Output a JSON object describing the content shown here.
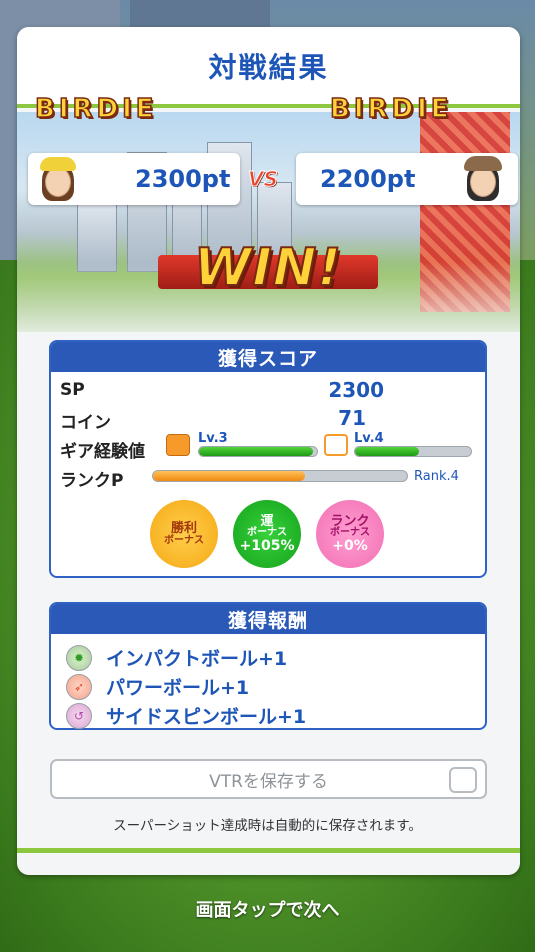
{
  "title": "対戦結果",
  "players": {
    "left": {
      "badge": "BIRDIE",
      "points": "2300pt"
    },
    "right": {
      "badge": "BIRDIE",
      "points": "2200pt"
    },
    "vs": "VS"
  },
  "result": "WIN!",
  "score": {
    "header": "獲得スコア",
    "sp_label": "SP",
    "sp_value": "2300",
    "coin_label": "コイン",
    "coin_value": "71",
    "gear_label": "ギア経験値",
    "gear1_level": "Lv.3",
    "gear1_progress": 0.97,
    "gear2_level": "Lv.4",
    "gear2_progress": 0.55,
    "rank_label": "ランクP",
    "rank_progress": 0.6,
    "rank_level": "Rank.4",
    "bonuses": [
      {
        "title": "勝利",
        "sub": "ボーナス",
        "value": ""
      },
      {
        "title": "運",
        "sub": "ボーナス",
        "value": "+105%"
      },
      {
        "title": "ランク",
        "sub": "ボーナス",
        "value": "+0%"
      }
    ]
  },
  "rewards": {
    "header": "獲得報酬",
    "items": [
      {
        "label": "インパクトボール+1",
        "icon": "impact-ball-icon"
      },
      {
        "label": "パワーボール+1",
        "icon": "power-ball-icon"
      },
      {
        "label": "サイドスピンボール+1",
        "icon": "sidespin-ball-icon"
      }
    ]
  },
  "vtr": {
    "label": "VTRを保存する",
    "note": "スーパーショット達成時は自動的に保存されます。"
  },
  "footer": {
    "tap_hint": "画面タップで次へ"
  },
  "colors": {
    "accent": "#1e56b8",
    "header": "#2a59b8",
    "green_line": "#8dc63f"
  }
}
